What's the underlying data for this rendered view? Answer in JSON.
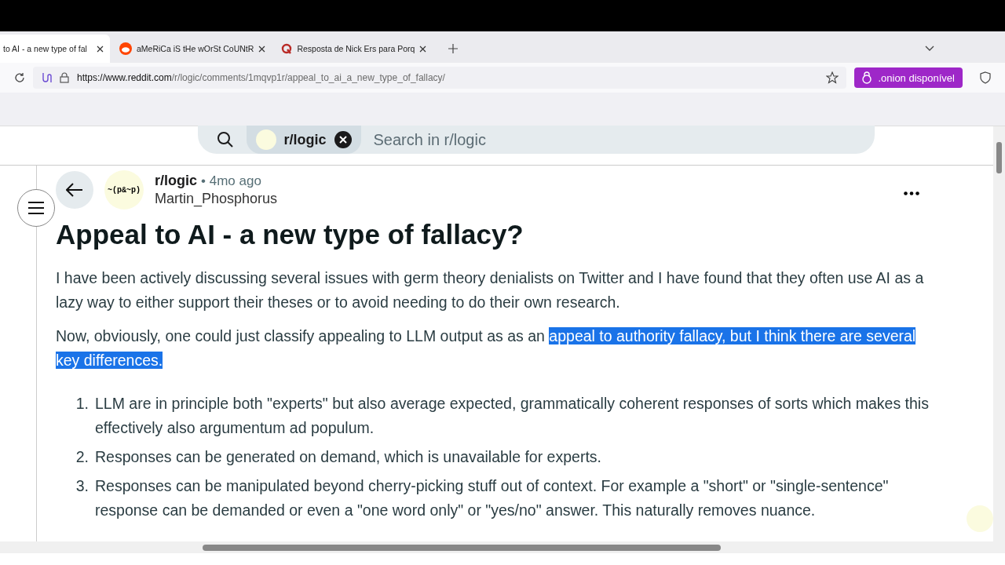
{
  "tabs": [
    {
      "title": "to AI - a new type of fal",
      "selected": true
    },
    {
      "title": "aMeRiCa iS tHe wOrSt CoUNtR",
      "selected": false
    },
    {
      "title": "Resposta de Nick Ers para Porq",
      "selected": false
    }
  ],
  "address": {
    "host": "https://www.reddit.com",
    "path": "/r/logic/comments/1mqvp1r/appeal_to_ai_a_new_type_of_fallacy/"
  },
  "onion_button": ".onion disponível",
  "search": {
    "chip": "r/logic",
    "placeholder": "Search in r/logic"
  },
  "post": {
    "subreddit": "r/logic",
    "age": "• 4mo ago",
    "author": "Martin_Phosphorus",
    "avatar_text": "~(p&~p)",
    "title": "Appeal to AI - a new type of fallacy?",
    "paragraphs": [
      [
        {
          "text": "I have been actively discussing several issues with germ theory denialists on Twitter and I have found that they often use AI as a lazy way to either support their theses or to avoid needing to do their own research.",
          "selected": false
        }
      ],
      [
        {
          "text": "Now, obviously, one could just classify appealing to LLM output as as an ",
          "selected": false
        },
        {
          "text": "appeal to authority fallacy, but I think there are several key differences.",
          "selected": true
        }
      ]
    ],
    "list": [
      {
        "marker": "1.",
        "text": "LLM are in principle both \"experts\" but also average expected, grammatically coherent responses of sorts which makes this effectively also argumentum ad populum."
      },
      {
        "marker": "2.",
        "text": "Responses can be generated on demand, which is unavailable for experts."
      },
      {
        "marker": "3.",
        "text": "Responses can be manipulated beyond cherry-picking stuff out of context. For example a \"short\" or \"single-sentence\" response can be demanded or even a \"one word only\" or \"yes/no\" answer. This naturally removes nuance."
      }
    ]
  }
}
